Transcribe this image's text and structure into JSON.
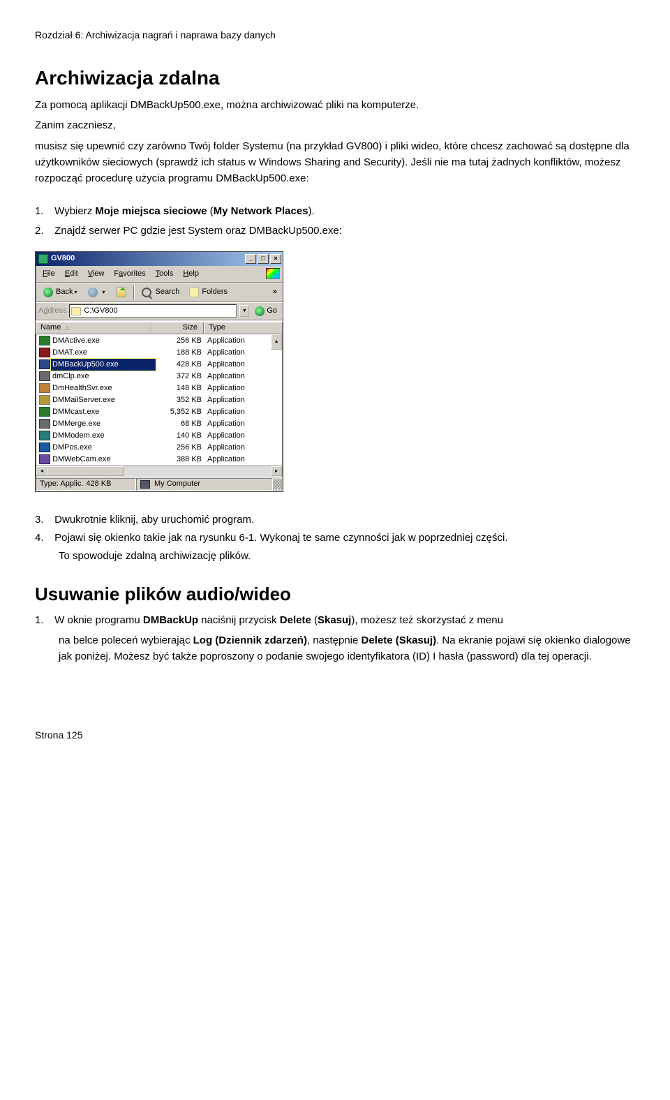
{
  "chapter_header": "Rozdział 6:   Archiwizacja nagrań i naprawa bazy danych",
  "section1": {
    "title": "Archiwizacja zdalna",
    "intro_line1": "Za pomocą aplikacji DMBackUp500.exe, można archiwizować pliki na komputerze.",
    "intro_line2_a": "Zanim zaczniesz,",
    "intro_line2_b": "musisz się upewnić czy zarówno Twój folder Systemu (na przykład GV800) i pliki wideo, które chcesz zachować są dostępne dla użytkowników sieciowych (sprawdź ich status w Windows Sharing and Security). Jeśli nie ma tutaj żadnych konfliktów, możesz rozpocząć procedurę użycia programu DMBackUp500.exe:",
    "step1_num": "1.",
    "step1_text": "Wybierz Moje miejsca sieciowe (My Network Places).",
    "step2_num": "2.",
    "step2_text": "Znajdź serwer PC gdzie jest System oraz DMBackUp500.exe:"
  },
  "window": {
    "title": "GV800",
    "min": "_",
    "max": "□",
    "close": "×",
    "menu": {
      "file": "File",
      "file_u": "F",
      "edit": "Edit",
      "edit_u": "E",
      "view": "View",
      "view_u": "V",
      "fav": "Favorites",
      "fav_u": "a",
      "tools": "Tools",
      "tools_u": "T",
      "help": "Help",
      "help_u": "H"
    },
    "toolbar": {
      "back": "Back",
      "search": "Search",
      "folders": "Folders",
      "chev": "»"
    },
    "addr_label": "Address",
    "addr_value": "C:\\GV800",
    "go": "Go",
    "col_name": "Name",
    "col_size": "Size",
    "col_type": "Type",
    "files": [
      {
        "name": "DMActive.exe",
        "size": "256 KB",
        "type": "Application"
      },
      {
        "name": "DMAT.exe",
        "size": "188 KB",
        "type": "Application"
      },
      {
        "name": "DMBackUp500.exe",
        "size": "428 KB",
        "type": "Application"
      },
      {
        "name": "dmClp.exe",
        "size": "372 KB",
        "type": "Application"
      },
      {
        "name": "DmHealthSvr.exe",
        "size": "148 KB",
        "type": "Application"
      },
      {
        "name": "DMMailServer.exe",
        "size": "352 KB",
        "type": "Application"
      },
      {
        "name": "DMMcast.exe",
        "size": "5,352 KB",
        "type": "Application"
      },
      {
        "name": "DMMerge.exe",
        "size": "68 KB",
        "type": "Application"
      },
      {
        "name": "DMModem.exe",
        "size": "140 KB",
        "type": "Application"
      },
      {
        "name": "DMPos.exe",
        "size": "256 KB",
        "type": "Application"
      },
      {
        "name": "DMWebCam.exe",
        "size": "388 KB",
        "type": "Application"
      }
    ],
    "status_type": "Type: Applic.",
    "status_size_word": "",
    "status_size": "428 KB",
    "status_mycomp": "My Computer",
    "sort_tri": "△",
    "down_arrow": "▾",
    "dd": "▼",
    "right_arrow": "▸",
    "left_scroll": "◂"
  },
  "section1b": {
    "step3_num": "3.",
    "step3_text": "Dwukrotnie kliknij, aby uruchomić program.",
    "step4_num": "4.",
    "step4_text": "Pojawi się okienko takie jak na rysunku 6-1. Wykonaj te same czynności jak w poprzedniej części.",
    "step4_cont": "To spowoduje zdalną archiwizację plików."
  },
  "section2": {
    "title": "Usuwanie plików audio/wideo",
    "step1_num": "1.",
    "step1_text_a": "W oknie programu ",
    "step1_b1": "DMBackUp",
    "step1_text_b": " naciśnij przycisk ",
    "step1_b2": "Delete",
    "step1_text_c": " (",
    "step1_b3": "Skasuj",
    "step1_text_d": "), możesz też skorzystać z menu",
    "step1_cont_a": "na belce poleceń wybierając ",
    "step1_cont_b1": "Log (Dziennik zdarzeń)",
    "step1_cont_b": ", następnie ",
    "step1_cont_b2": "Delete (Skasuj)",
    "step1_cont_c": ". Na ekranie pojawi się okienko dialogowe jak poniżej. Możesz być także poproszony o podanie swojego identyfikatora (ID) I hasła (password) dla tej operacji."
  },
  "footer": "Strona 125"
}
